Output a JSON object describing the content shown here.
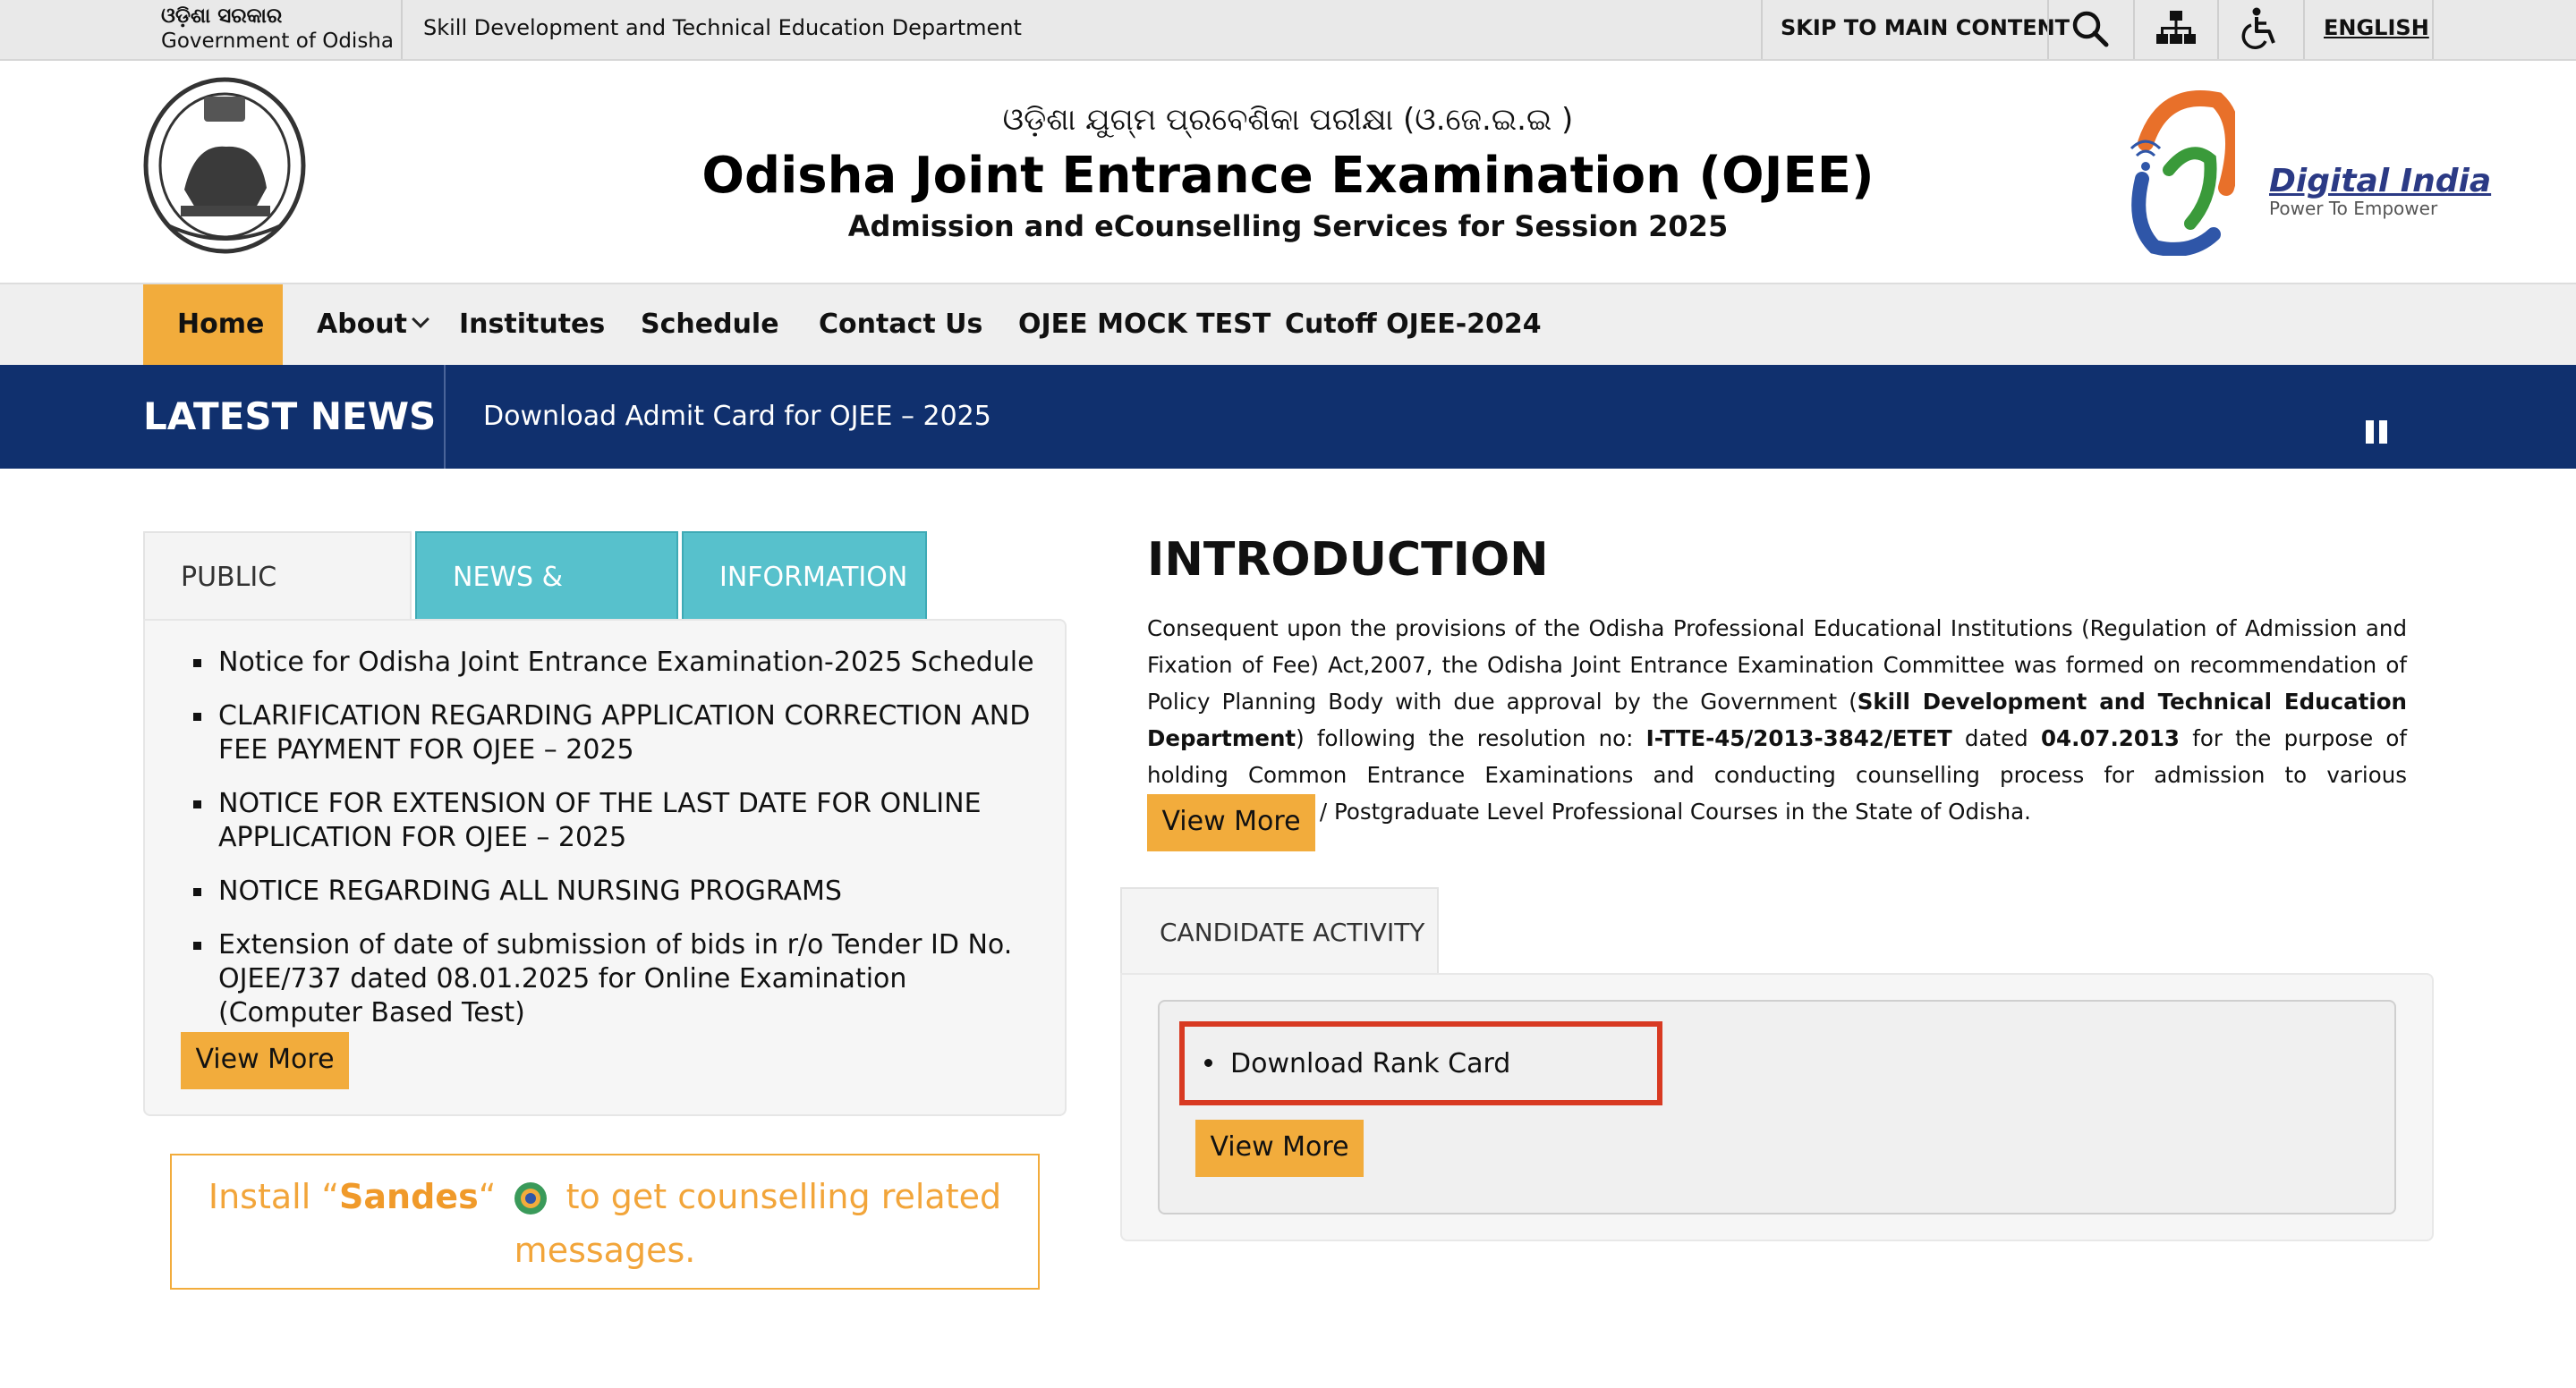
{
  "topbar": {
    "gov_odia": "ଓଡ଼ିଶା ସରକାର",
    "gov_english": "Government of Odisha",
    "department": "Skill Development and Technical Education Department",
    "skip_link": "SKIP TO MAIN CONTENT",
    "language_link": "ENGLISH",
    "icons": [
      "search-icon",
      "sitemap-icon",
      "accessibility-icon"
    ]
  },
  "header": {
    "title_odia": "ଓଡ଼ିଶା ଯୁଗ୍ମ ପ୍ରବେଶିକା ପରୀକ୍ଷା (ଓ.ଜେ.ଇ.ଇ )",
    "title": "Odisha Joint Entrance Examination (OJEE)",
    "subtitle": "Admission and eCounselling Services for Session 2025",
    "digital_india": "Digital India",
    "digital_india_tagline": "Power To Empower"
  },
  "nav": {
    "items": [
      "Home",
      "About",
      "Institutes",
      "Schedule",
      "Contact Us",
      "OJEE MOCK TEST",
      "Cutoff OJEE-2024"
    ],
    "active": "Home"
  },
  "news": {
    "label": "LATEST NEWS",
    "text": "Download Admit Card for OJEE – 2025"
  },
  "tabs": {
    "items": [
      "PUBLIC NOTICES",
      "NEWS & EVENTS",
      "INFORMATION"
    ],
    "active": "PUBLIC NOTICES"
  },
  "notices": [
    "Notice for Odisha Joint Entrance Examination-2025 Schedule",
    "CLARIFICATION REGARDING APPLICATION CORRECTION AND FEE PAYMENT FOR OJEE – 2025",
    "NOTICE FOR EXTENSION OF THE LAST DATE FOR ONLINE APPLICATION FOR OJEE – 2025",
    "NOTICE REGARDING ALL NURSING PROGRAMS",
    "Extension of date of submission of bids in r/o Tender ID No. OJEE/737 dated 08.01.2025 for Online Examination (Computer Based Test)"
  ],
  "view_more_label": "View More",
  "sandes": {
    "prefix": "Install “",
    "name": "Sandes",
    "suffix_quote": "“",
    "line_end": "to get counselling related",
    "line2": "messages."
  },
  "intro": {
    "title": "INTRODUCTION",
    "text_1": "Consequent upon the provisions of the Odisha Professional Educational Institutions (Regulation of Admission and Fixation of Fee) Act,2007, the Odisha Joint Entrance Examination Committee was formed on recommendation of Policy Planning Body with due approval by the Government (",
    "text_bold_1": "Skill Development and Technical Education Department",
    "text_2": ") following the resolution no: ",
    "text_bold_2": "I-TTE-45/2013-3842/ETET",
    "text_3": " dated ",
    "text_bold_3": "04.07.2013",
    "text_4": " for the purpose of holding Common Entrance Examinations and conducting counselling process for admission to various Undergraduate / Postgraduate Level Professional Courses in the State of Odisha."
  },
  "candidate_activity": {
    "tab_label": "CANDIDATE ACTIVITY",
    "items": [
      "Download Rank Card"
    ]
  },
  "colors": {
    "accent_orange": "#f2ac3c",
    "news_navy": "#10306e",
    "tab_teal": "#57c1cc",
    "highlight_red": "#d83a22"
  }
}
